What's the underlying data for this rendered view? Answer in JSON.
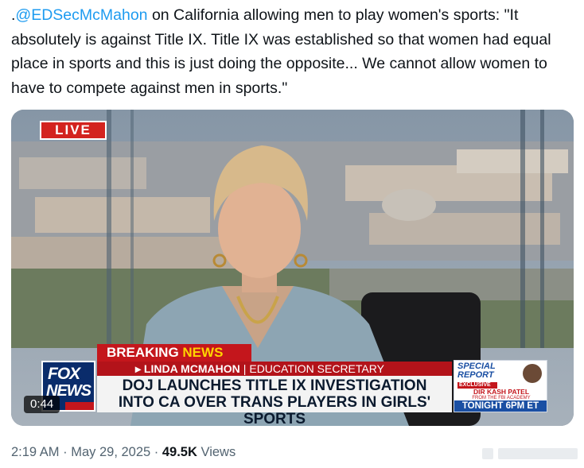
{
  "tweet": {
    "prefix": ".",
    "mention": "@EDSecMcMahon",
    "text": " on California allowing men to play women's sports: \"It absolutely is against Title IX. Title IX was established so that women had equal place in sports and this is just doing the opposite... We cannot allow women to have to compete against men in sports.\""
  },
  "video": {
    "live_label": "LIVE",
    "breaking_label": "BREAKING",
    "news_label": "NEWS",
    "speaker_name": "▸ LINDA MCMAHON",
    "separator": "|",
    "speaker_title": "EDUCATION SECRETARY",
    "headline_line1": "DOJ LAUNCHES TITLE IX INVESTIGATION",
    "headline_line2": "INTO CA OVER TRANS PLAYERS IN GIRLS' SPORTS",
    "logo_top": "FOX",
    "logo_bottom": "NEWS",
    "special_report_line1": "SPECIAL",
    "special_report_line2": "REPORT",
    "exclusive_label": "EXCLUSIVE",
    "guest_name": "DIR KASH PATEL",
    "guest_sub": "FROM THE FBI ACADEMY",
    "tonight_label": "TONIGHT 6PM ET",
    "duration": "0:44"
  },
  "footer": {
    "time": "2:19 AM",
    "dot1": " · ",
    "date": "May 29, 2025",
    "dot2": " · ",
    "views_count": "49.5K",
    "views_label": " Views"
  },
  "colors": {
    "mention": "#1d9bf0",
    "live_red": "#d3231f",
    "fox_navy": "#0a2c6b",
    "breaking_yellow": "#ffd400"
  }
}
